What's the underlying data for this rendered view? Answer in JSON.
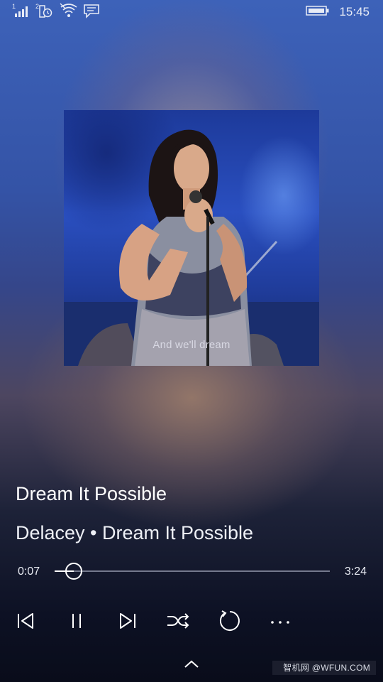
{
  "status_bar": {
    "time": "15:45",
    "sim1_label": "1",
    "sim2_label": "2",
    "icons": [
      "signal-bars-icon",
      "sim2-signal-icon",
      "wifi-icon",
      "message-icon",
      "battery-icon"
    ]
  },
  "player": {
    "album_art_caption": "And we'll dream",
    "track_title": "Dream It Possible",
    "artist_album": "Delacey • Dream It Possible",
    "elapsed": "0:07",
    "duration": "3:24",
    "progress_fraction": 0.034
  },
  "controls": {
    "previous": "previous-icon",
    "play_pause": "pause-icon",
    "next": "next-icon",
    "shuffle": "shuffle-icon",
    "repeat": "repeat-icon",
    "more": "more-icon",
    "expand": "chevron-up-icon"
  },
  "watermark": {
    "text": "智机网 @WFUN.COM"
  },
  "colors": {
    "accent": "#ffffff",
    "top_background": "#3d62b9",
    "bottom_background": "#0d1124"
  }
}
